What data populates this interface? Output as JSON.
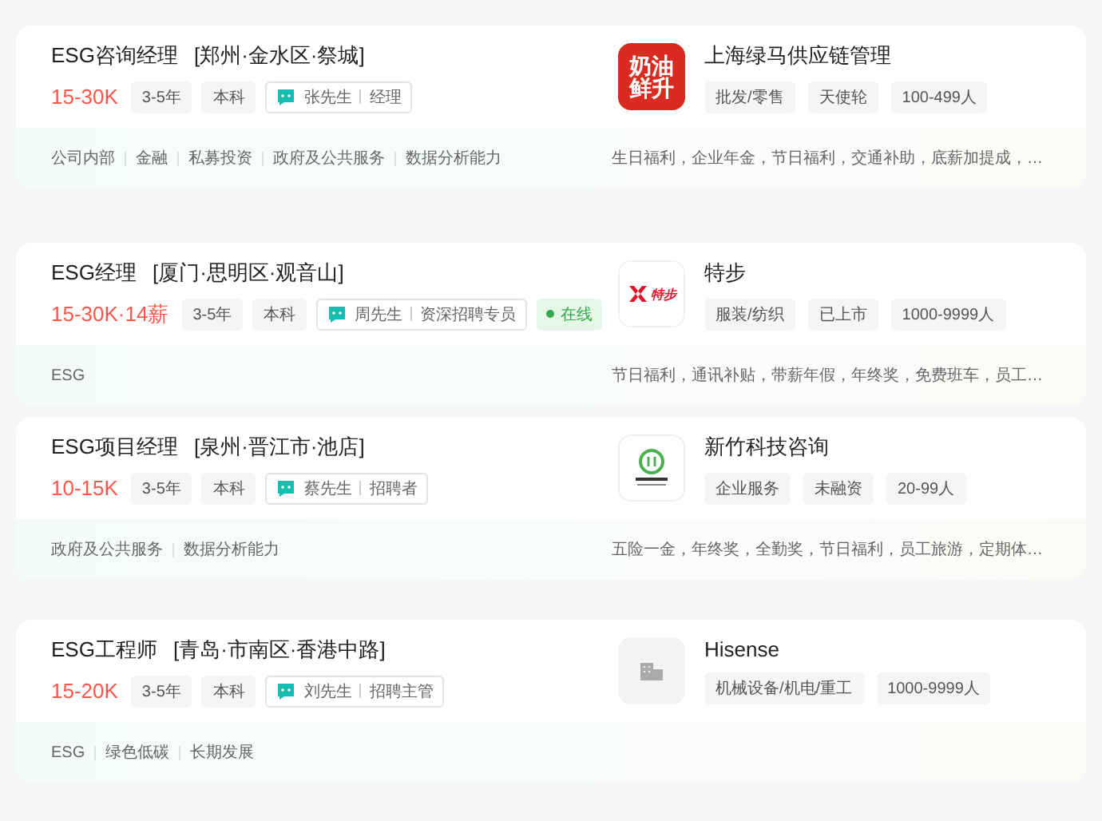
{
  "jobs": [
    {
      "title": "ESG咨询经理",
      "location": "[郑州·金水区·祭城]",
      "salary": "15-30K",
      "tags": [
        "3-5年",
        "本科"
      ],
      "recruiter": "张先生",
      "recruiter_role": "经理",
      "online": false,
      "company": {
        "name": "上海绿马供应链管理",
        "logo": {
          "kind": "text",
          "text": "奶油鲜升"
        },
        "tags": [
          "批发/零售",
          "天使轮",
          "100-499人"
        ]
      },
      "skills": [
        "公司内部",
        "金融",
        "私募投资",
        "政府及公共服务",
        "数据分析能力"
      ],
      "benefits": "生日福利，企业年金，节日福利，交通补助，底薪加提成，…"
    },
    {
      "title": "ESG经理",
      "location": "[厦门·思明区·观音山]",
      "salary": "15-30K·14薪",
      "tags": [
        "3-5年",
        "本科"
      ],
      "recruiter": "周先生",
      "recruiter_role": "资深招聘专员",
      "online": true,
      "online_label": "在线",
      "company": {
        "name": "特步",
        "logo": {
          "kind": "brand",
          "text": "特步"
        },
        "tags": [
          "服装/纺织",
          "已上市",
          "1000-9999人"
        ]
      },
      "skills": [
        "ESG"
      ],
      "benefits": "节日福利，通讯补贴，带薪年假，年终奖，免费班车，员工…"
    },
    {
      "title": "ESG项目经理",
      "location": "[泉州·晋江市·池店]",
      "salary": "10-15K",
      "tags": [
        "3-5年",
        "本科"
      ],
      "recruiter": "蔡先生",
      "recruiter_role": "招聘者",
      "online": false,
      "company": {
        "name": "新竹科技咨询",
        "logo": {
          "kind": "emblem"
        },
        "tags": [
          "企业服务",
          "未融资",
          "20-99人"
        ]
      },
      "skills": [
        "政府及公共服务",
        "数据分析能力"
      ],
      "benefits": "五险一金，年终奖，全勤奖，节日福利，员工旅游，定期体…"
    },
    {
      "title": "ESG工程师",
      "location": "[青岛·市南区·香港中路]",
      "salary": "15-20K",
      "tags": [
        "3-5年",
        "本科"
      ],
      "recruiter": "刘先生",
      "recruiter_role": "招聘主管",
      "online": false,
      "company": {
        "name": "Hisense",
        "logo": {
          "kind": "placeholder"
        },
        "tags": [
          "机械设备/机电/重工",
          "1000-9999人"
        ]
      },
      "skills": [
        "ESG",
        "绿色低碳",
        "长期发展"
      ]
    }
  ]
}
